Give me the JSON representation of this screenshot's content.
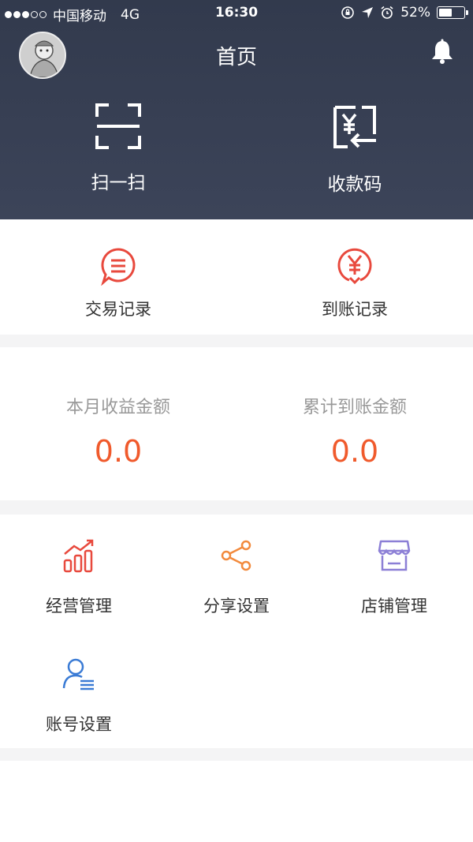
{
  "status_bar": {
    "carrier": "中国移动",
    "network": "4G",
    "time": "16:30",
    "battery": "52%",
    "battery_level": 0.52
  },
  "header": {
    "title": "首页",
    "actions": [
      {
        "label": "扫一扫",
        "icon": "scan-icon"
      },
      {
        "label": "收款码",
        "icon": "receive-code-icon"
      }
    ]
  },
  "records": [
    {
      "label": "交易记录",
      "icon": "transaction-record-icon"
    },
    {
      "label": "到账记录",
      "icon": "arrival-record-icon"
    }
  ],
  "stats": [
    {
      "label": "本月收益金额",
      "value": "0.0"
    },
    {
      "label": "累计到账金额",
      "value": "0.0"
    }
  ],
  "menu": [
    {
      "label": "经营管理",
      "icon": "business-chart-icon"
    },
    {
      "label": "分享设置",
      "icon": "share-icon"
    },
    {
      "label": "店铺管理",
      "icon": "store-icon"
    },
    {
      "label": "账号设置",
      "icon": "account-settings-icon"
    }
  ],
  "colors": {
    "header_bg": "#363e52",
    "amount": "#f05a2c",
    "record_icon": "#e8493d",
    "chart_icon": "#e8493d",
    "share_icon": "#f28a3d",
    "store_icon": "#8c7fd6",
    "account_icon": "#3a7bd5"
  }
}
